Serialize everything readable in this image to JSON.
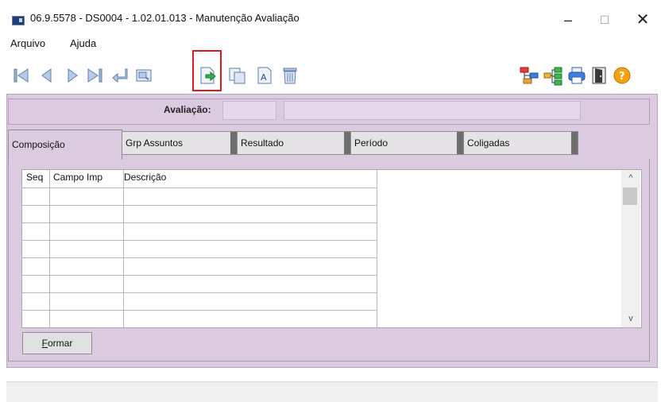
{
  "window": {
    "title": "06.9.5578 - DS0004 - 1.02.01.013 - Manutenção Avaliação",
    "minimize": "–",
    "maximize": "☐",
    "close": "✕"
  },
  "menu": [
    "Arquivo",
    "Ajuda"
  ],
  "toolbar": {
    "left_icons": [
      "first-record-icon",
      "previous-record-icon",
      "next-record-icon",
      "last-record-icon",
      "enter-icon",
      "preview-icon",
      "new-record-icon",
      "copy-icon",
      "text-edit-icon",
      "delete-icon"
    ],
    "right_icons": [
      "hierarchy-icon",
      "tree-icon",
      "print-icon",
      "exit-door-icon",
      "help-icon"
    ],
    "highlighted": "new-record-icon",
    "highlight_color": "#e11b1b"
  },
  "form": {
    "avaliacao_label": "Avaliação:",
    "avaliacao_code": "",
    "avaliacao_desc": ""
  },
  "tabs": [
    "Composição",
    "Grp Assuntos",
    "Resultado",
    "Período",
    "Coligadas"
  ],
  "active_tab": "Composição",
  "grid": {
    "columns": [
      "Seq",
      "Campo Imp",
      "Descrição"
    ],
    "rows": 7
  },
  "scroll": {
    "up": "^",
    "down": "v"
  },
  "buttons": {
    "formar": "Formar"
  },
  "colors": {
    "panel": "#dccbe0",
    "tab": "#e6e3e6"
  }
}
